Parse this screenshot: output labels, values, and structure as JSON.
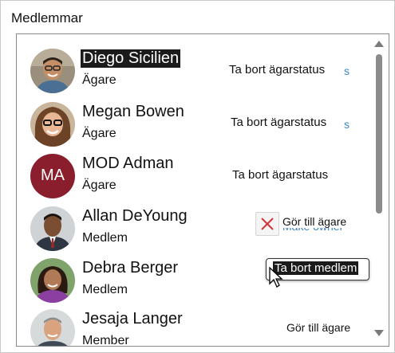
{
  "section": {
    "title": "Medlemmar"
  },
  "members": [
    {
      "name": "Diego Sicilien",
      "role": "Ägare",
      "action": "Ta bort ägarstatus",
      "selected": true,
      "avatar": "photo-man-glasses"
    },
    {
      "name": "Megan Bowen",
      "role": "Ägare",
      "action": "Ta bort ägarstatus",
      "avatar": "photo-woman-glasses"
    },
    {
      "name": "MOD Adman",
      "role": "Ägare",
      "action": "Ta bort ägarstatus",
      "avatar": "initials",
      "initials": "MA",
      "avatar_color": "#8b1e2d"
    },
    {
      "name": "Allan DeYoung",
      "role": "Medlem",
      "action": "Gör till ägare",
      "ghost_action": "Make owner",
      "avatar": "photo-man-suit"
    },
    {
      "name": "Debra Berger",
      "role": "Medlem",
      "avatar": "photo-woman-purple"
    },
    {
      "name": "Jesaja Langer",
      "role": "Member",
      "action": "Gör till ägare",
      "avatar": "photo-man-gray"
    }
  ],
  "tooltip": {
    "text": "Ta bort medlem"
  },
  "icons": {
    "remove": "close-icon",
    "cursor": "pointer-icon",
    "scroll_up": "chevron-up-icon",
    "scroll_down": "chevron-down-icon"
  },
  "colors": {
    "accent": "#d13438",
    "link": "#3c86c6",
    "selection": "#1b1b1b"
  }
}
